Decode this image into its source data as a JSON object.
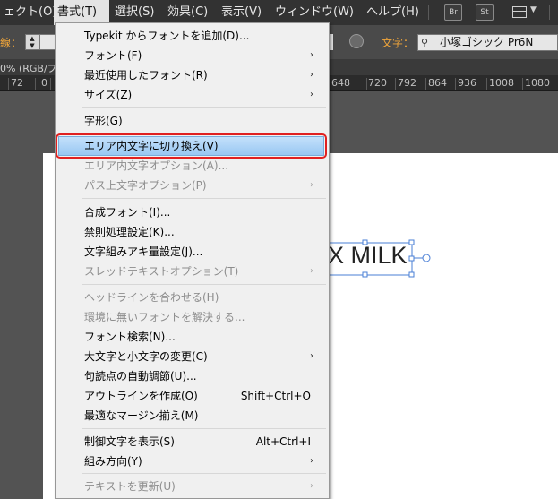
{
  "menubar": {
    "items": [
      "ェクト(O)",
      "書式(T)",
      "選択(S)",
      "効果(C)",
      "表示(V)",
      "ウィンドウ(W)",
      "ヘルプ(H)"
    ],
    "icons": [
      "Br",
      "St"
    ]
  },
  "control": {
    "stroke_label": "線：",
    "char_label": "文字：",
    "font_value": "小塚ゴシック Pr6N"
  },
  "tab_text": "0% (RGB/プ",
  "ruler": {
    "left": [
      "72",
      "0",
      "0"
    ],
    "right": [
      "648",
      "720",
      "792",
      "864",
      "936",
      "1008",
      "1080"
    ]
  },
  "canvas_text": "X MILK",
  "menu": {
    "items": [
      {
        "label": "Typekit からフォントを追加(D)...",
        "shortcut": "",
        "arrow": false,
        "disabled": false
      },
      {
        "label": "フォント(F)",
        "shortcut": "",
        "arrow": true,
        "disabled": false
      },
      {
        "label": "最近使用したフォント(R)",
        "shortcut": "",
        "arrow": true,
        "disabled": false
      },
      {
        "label": "サイズ(Z)",
        "shortcut": "",
        "arrow": true,
        "disabled": false
      },
      {
        "label": "字形(G)",
        "shortcut": "",
        "arrow": false,
        "disabled": false
      },
      {
        "label": "エリア内文字に切り換え(V)",
        "shortcut": "",
        "arrow": false,
        "disabled": false,
        "highlighted": true
      },
      {
        "label": "エリア内文字オプション(A)...",
        "shortcut": "",
        "arrow": false,
        "disabled": true
      },
      {
        "label": "パス上文字オプション(P)",
        "shortcut": "",
        "arrow": true,
        "disabled": true
      },
      {
        "label": "合成フォント(I)...",
        "shortcut": "",
        "arrow": false,
        "disabled": false
      },
      {
        "label": "禁則処理設定(K)...",
        "shortcut": "",
        "arrow": false,
        "disabled": false
      },
      {
        "label": "文字組みアキ量設定(J)...",
        "shortcut": "",
        "arrow": false,
        "disabled": false
      },
      {
        "label": "スレッドテキストオプション(T)",
        "shortcut": "",
        "arrow": true,
        "disabled": true
      },
      {
        "label": "ヘッドラインを合わせる(H)",
        "shortcut": "",
        "arrow": false,
        "disabled": true
      },
      {
        "label": "環境に無いフォントを解決する...",
        "shortcut": "",
        "arrow": false,
        "disabled": true
      },
      {
        "label": "フォント検索(N)...",
        "shortcut": "",
        "arrow": false,
        "disabled": false
      },
      {
        "label": "大文字と小文字の変更(C)",
        "shortcut": "",
        "arrow": true,
        "disabled": false
      },
      {
        "label": "句読点の自動調節(U)...",
        "shortcut": "",
        "arrow": false,
        "disabled": false
      },
      {
        "label": "アウトラインを作成(O)",
        "shortcut": "Shift+Ctrl+O",
        "arrow": false,
        "disabled": false
      },
      {
        "label": "最適なマージン揃え(M)",
        "shortcut": "",
        "arrow": false,
        "disabled": false
      },
      {
        "label": "制御文字を表示(S)",
        "shortcut": "Alt+Ctrl+I",
        "arrow": false,
        "disabled": false
      },
      {
        "label": "組み方向(Y)",
        "shortcut": "",
        "arrow": true,
        "disabled": false
      },
      {
        "label": "テキストを更新(U)",
        "shortcut": "",
        "arrow": true,
        "disabled": true
      }
    ]
  }
}
